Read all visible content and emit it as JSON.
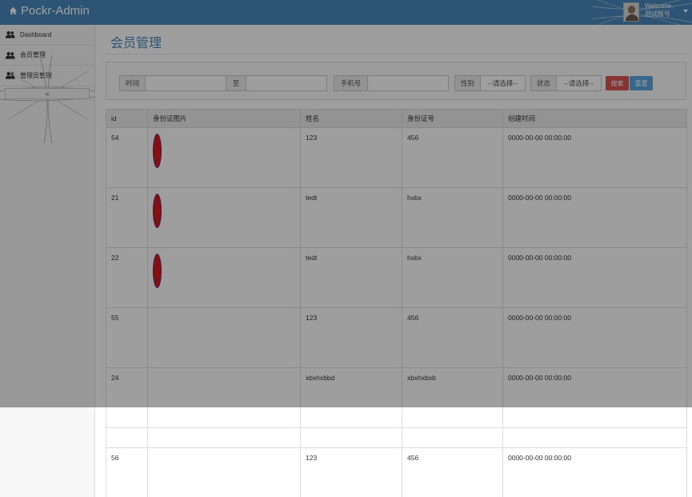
{
  "header": {
    "brand": "Pockr-Admin",
    "welcome_line1": "Welcome,",
    "welcome_line2": "测试账号"
  },
  "sidebar": {
    "items": [
      {
        "label": "Dashboard",
        "icon": "users-icon"
      },
      {
        "label": "会员管理",
        "icon": "users-icon"
      },
      {
        "label": "管理员管理",
        "icon": "users-icon"
      }
    ],
    "collapse_label": "«"
  },
  "main": {
    "title": "会员管理"
  },
  "search": {
    "time_label": "时间",
    "to_label": "至",
    "phone_label": "手机号",
    "gender_label": "性别",
    "gender_value": "--请选择--",
    "status_label": "状态",
    "status_value": "--请选择--",
    "search_button": "搜索",
    "reset_button": "重置"
  },
  "table": {
    "columns": [
      "id",
      "身份证图片",
      "姓名",
      "身份证号",
      "创建时间"
    ],
    "rows": [
      {
        "id": "54",
        "has_image": true,
        "name": "123",
        "id_number": "456",
        "created": "0000-00-00 00:00:00"
      },
      {
        "id": "21",
        "has_image": true,
        "name": "tedt",
        "id_number": "hxbx",
        "created": "0000-00-00 00:00:00"
      },
      {
        "id": "22",
        "has_image": true,
        "name": "tedt",
        "id_number": "hxbx",
        "created": "0000-00-00 00:00:00"
      },
      {
        "id": "55",
        "has_image": false,
        "name": "123",
        "id_number": "456",
        "created": "0000-00-00 00:00:00"
      },
      {
        "id": "24",
        "has_image": false,
        "name": "xbxhxbbd",
        "id_number": "xbxhxbxb",
        "created": "0000-00-00 00:00:00"
      },
      {
        "id": "",
        "has_image": false,
        "name": "",
        "id_number": "",
        "created": ""
      },
      {
        "id": "56",
        "has_image": false,
        "name": "123",
        "id_number": "456",
        "created": "0000-00-00 00:00:00"
      }
    ]
  },
  "colors": {
    "header_bg": "#4a88bd",
    "search_button": "#d9534f",
    "reset_button": "#5ba6e0",
    "image_fill": "#d31b20"
  }
}
